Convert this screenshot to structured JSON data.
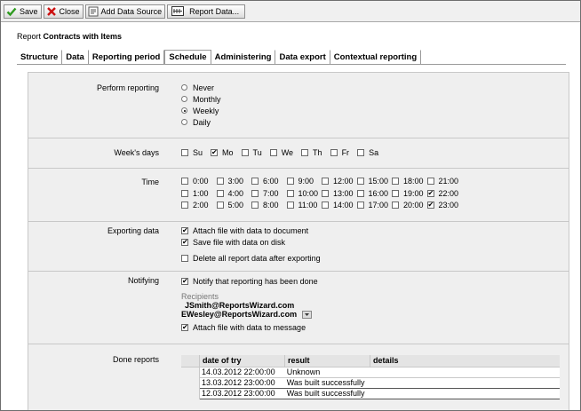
{
  "toolbar": {
    "save": "Save",
    "close": "Close",
    "add_data_source": "Add Data Source",
    "report_data": "Report Data..."
  },
  "report": {
    "prefix": "Report",
    "name": "Contracts with Items"
  },
  "tabs": [
    {
      "label": "Structure",
      "active": false
    },
    {
      "label": "Data",
      "active": false
    },
    {
      "label": "Reporting period",
      "active": false
    },
    {
      "label": "Schedule",
      "active": true
    },
    {
      "label": "Administering",
      "active": false
    },
    {
      "label": "Data export",
      "active": false
    },
    {
      "label": "Contextual reporting",
      "active": false
    }
  ],
  "perform": {
    "label": "Perform reporting",
    "options": [
      {
        "label": "Never",
        "selected": false
      },
      {
        "label": "Monthly",
        "selected": false
      },
      {
        "label": "Weekly",
        "selected": true
      },
      {
        "label": "Daily",
        "selected": false
      }
    ]
  },
  "weekdays": {
    "label": "Week's days",
    "days": [
      {
        "label": "Su",
        "checked": false
      },
      {
        "label": "Mo",
        "checked": true
      },
      {
        "label": "Tu",
        "checked": false
      },
      {
        "label": "We",
        "checked": false
      },
      {
        "label": "Th",
        "checked": false
      },
      {
        "label": "Fr",
        "checked": false
      },
      {
        "label": "Sa",
        "checked": false
      }
    ]
  },
  "time": {
    "label": "Time",
    "hours": [
      {
        "label": "0:00",
        "checked": false
      },
      {
        "label": "3:00",
        "checked": false
      },
      {
        "label": "6:00",
        "checked": false
      },
      {
        "label": "9:00",
        "checked": false
      },
      {
        "label": "12:00",
        "checked": false
      },
      {
        "label": "15:00",
        "checked": false
      },
      {
        "label": "18:00",
        "checked": false
      },
      {
        "label": "21:00",
        "checked": false
      },
      {
        "label": "1:00",
        "checked": false
      },
      {
        "label": "4:00",
        "checked": false
      },
      {
        "label": "7:00",
        "checked": false
      },
      {
        "label": "10:00",
        "checked": false
      },
      {
        "label": "13:00",
        "checked": false
      },
      {
        "label": "16:00",
        "checked": false
      },
      {
        "label": "19:00",
        "checked": false
      },
      {
        "label": "22:00",
        "checked": true
      },
      {
        "label": "2:00",
        "checked": false
      },
      {
        "label": "5:00",
        "checked": false
      },
      {
        "label": "8:00",
        "checked": false
      },
      {
        "label": "11:00",
        "checked": false
      },
      {
        "label": "14:00",
        "checked": false
      },
      {
        "label": "17:00",
        "checked": false
      },
      {
        "label": "20:00",
        "checked": false
      },
      {
        "label": "23:00",
        "checked": true
      }
    ]
  },
  "exporting": {
    "label": "Exporting data",
    "attach": {
      "label": "Attach file with data to document",
      "checked": true
    },
    "save": {
      "label": "Save file with data on disk",
      "checked": true
    },
    "delete": {
      "label": "Delete all report data after exporting",
      "checked": false
    }
  },
  "notifying": {
    "label": "Notifying",
    "notify": {
      "label": "Notify that reporting has been done",
      "checked": true
    },
    "recipients_label": "Recipients",
    "recipients": [
      "JSmith@ReportsWizard.com",
      "EWesley@ReportsWizard.com"
    ],
    "attach": {
      "label": "Attach file with data to message",
      "checked": true
    }
  },
  "done": {
    "label": "Done reports",
    "columns": [
      "date of try",
      "result",
      "details"
    ],
    "rows": [
      {
        "date": "14.03.2012 22:00:00",
        "result": "Unknown",
        "details": ""
      },
      {
        "date": "13.03.2012 23:00:00",
        "result": "Was built successfully",
        "details": ""
      },
      {
        "date": "12.03.2012 23:00:00",
        "result": "Was built successfully",
        "details": ""
      }
    ]
  },
  "colors": {
    "save_check": "#2e9a1f",
    "close_x": "#cc1111",
    "panel_bg": "#efefef",
    "border": "#c8c8c8"
  }
}
